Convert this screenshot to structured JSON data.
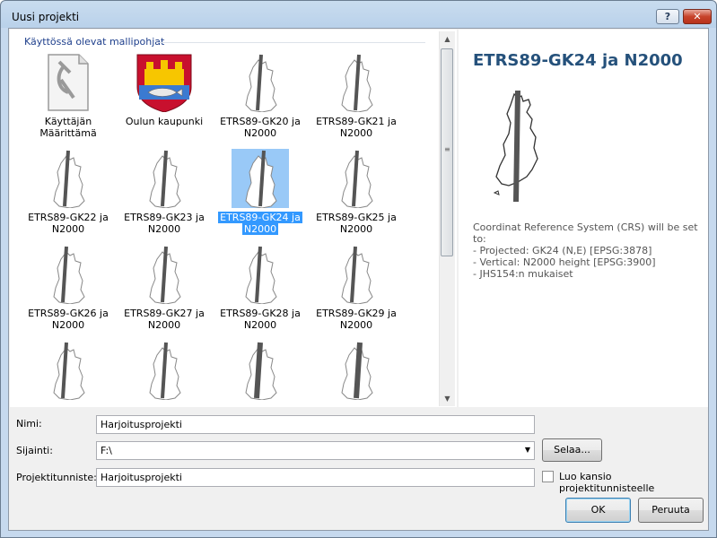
{
  "window": {
    "title": "Uusi projekti",
    "help_label": "?",
    "close_label": "✕"
  },
  "templates": {
    "group_header": "Käyttössä olevat mallipohjat",
    "items": [
      {
        "label1": "Käyttäjän",
        "label2": "Määrittämä",
        "icon": "document-icon"
      },
      {
        "label1": "Oulun kaupunki",
        "label2": "",
        "icon": "oulu-coat-of-arms"
      },
      {
        "label1": "ETRS89-GK20 ja",
        "label2": "N2000",
        "icon": "finland-map-icon"
      },
      {
        "label1": "ETRS89-GK21 ja",
        "label2": "N2000",
        "icon": "finland-map-icon"
      },
      {
        "label1": "ETRS89-GK22 ja",
        "label2": "N2000",
        "icon": "finland-map-icon"
      },
      {
        "label1": "ETRS89-GK23 ja",
        "label2": "N2000",
        "icon": "finland-map-icon"
      },
      {
        "label1": "ETRS89-GK24 ja",
        "label2": "N2000",
        "icon": "finland-map-icon"
      },
      {
        "label1": "ETRS89-GK25 ja",
        "label2": "N2000",
        "icon": "finland-map-icon"
      },
      {
        "label1": "ETRS89-GK26 ja",
        "label2": "N2000",
        "icon": "finland-map-icon"
      },
      {
        "label1": "ETRS89-GK27 ja",
        "label2": "N2000",
        "icon": "finland-map-icon"
      },
      {
        "label1": "ETRS89-GK28 ja",
        "label2": "N2000",
        "icon": "finland-map-icon"
      },
      {
        "label1": "ETRS89-GK29 ja",
        "label2": "N2000",
        "icon": "finland-map-icon"
      }
    ],
    "selected_index": 6
  },
  "preview": {
    "title": "ETRS89-GK24 ja N2000",
    "desc_line1": "Coordinat Reference System (CRS) will be set to:",
    "desc_line2": "- Projected: GK24 (N,E) [EPSG:3878]",
    "desc_line3": "- Vertical: N2000 height [EPSG:3900]",
    "desc_line4": "- JHS154:n mukaiset"
  },
  "form": {
    "name_label": "Nimi:",
    "name_value": "Harjoitusprojekti",
    "location_label": "Sijainti:",
    "location_value": "F:\\",
    "browse_label": "Selaa...",
    "project_id_label": "Projektitunniste:",
    "project_id_value": "Harjoitusprojekti",
    "create_folder_label": "Luo kansio projektitunnisteelle",
    "create_folder_checked": false
  },
  "buttons": {
    "ok_label": "OK",
    "cancel_label": "Peruuta"
  },
  "colors": {
    "selection": "#3399ff",
    "selection_thumb": "#99c9f7",
    "header_text": "#1e3f8c",
    "preview_title": "#25517b"
  }
}
